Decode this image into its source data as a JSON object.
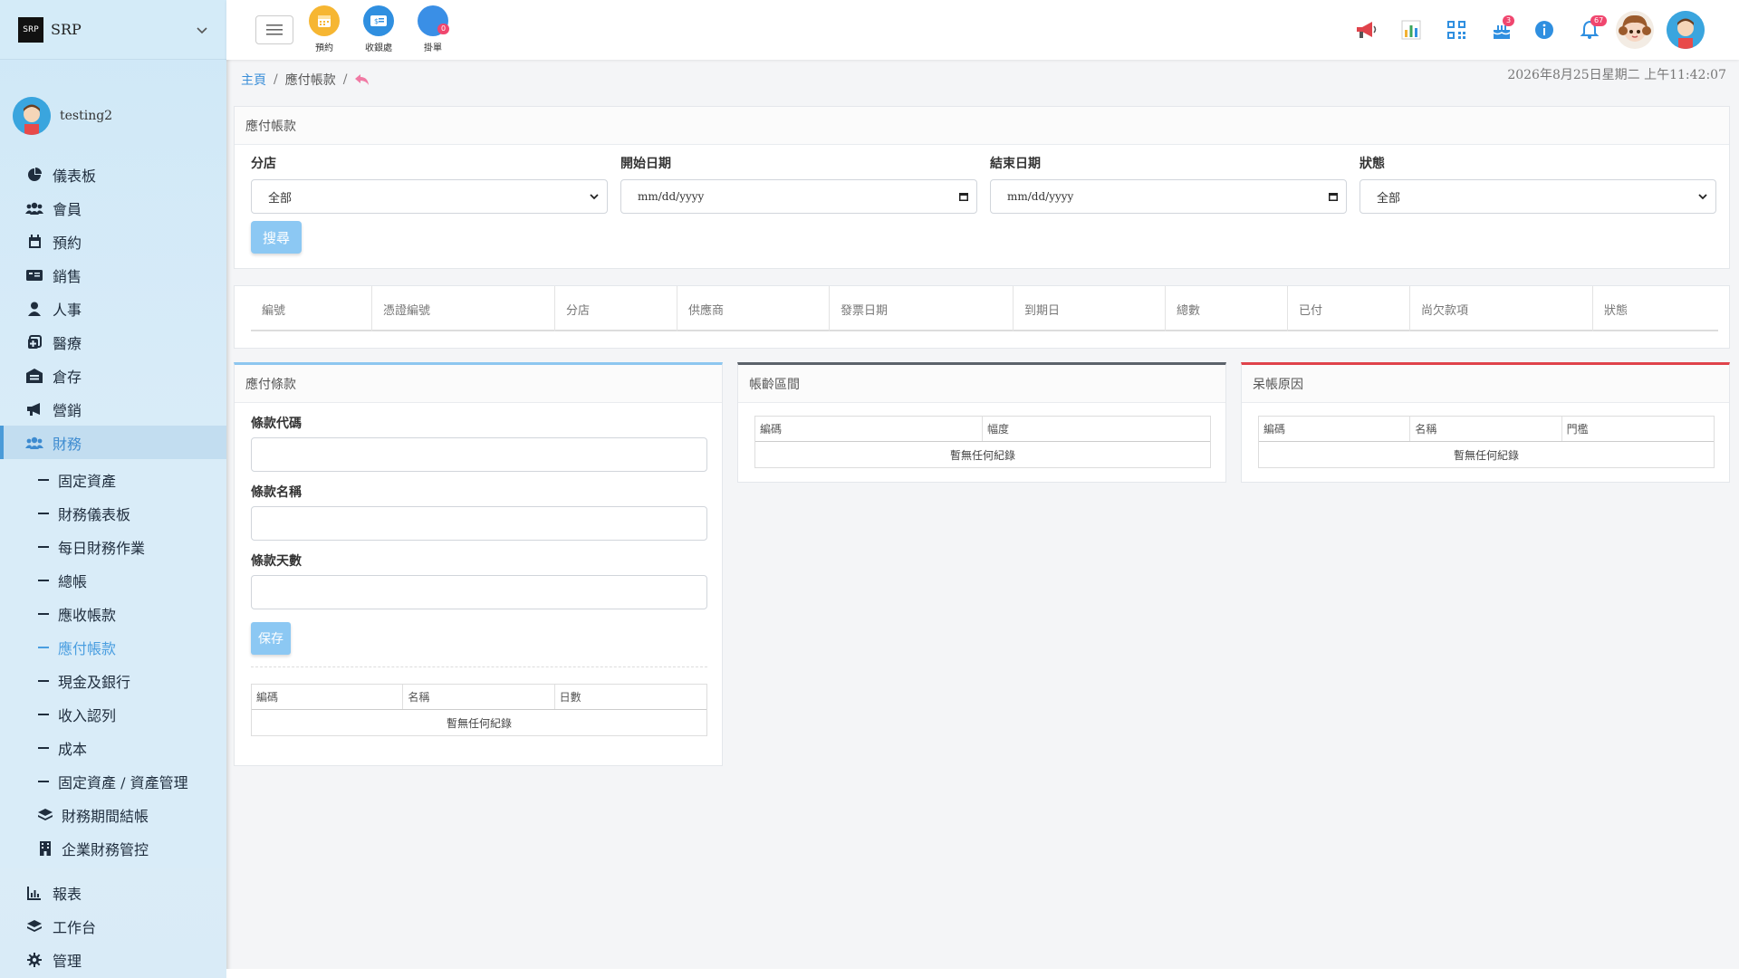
{
  "brand": {
    "name": "SRP",
    "logo_text": "SRP"
  },
  "user": {
    "name": "testing2"
  },
  "sidebar": {
    "items": [
      {
        "label": "儀表板",
        "icon": "pie-chart-icon"
      },
      {
        "label": "會員",
        "icon": "users-icon"
      },
      {
        "label": "預約",
        "icon": "calendar-icon"
      },
      {
        "label": "銷售",
        "icon": "id-card-icon"
      },
      {
        "label": "人事",
        "icon": "person-icon"
      },
      {
        "label": "醫療",
        "icon": "medical-icon"
      },
      {
        "label": "倉存",
        "icon": "warehouse-icon"
      },
      {
        "label": "營銷",
        "icon": "megaphone-icon"
      },
      {
        "label": "財務",
        "icon": "finance-users-icon"
      }
    ],
    "finance_sub": [
      {
        "label": "固定資產"
      },
      {
        "label": "財務儀表板"
      },
      {
        "label": "每日財務作業"
      },
      {
        "label": "總帳"
      },
      {
        "label": "應收帳款"
      },
      {
        "label": "應付帳款"
      },
      {
        "label": "現金及銀行"
      },
      {
        "label": "收入認列"
      },
      {
        "label": "成本"
      },
      {
        "label": "固定資產 / 資產管理"
      },
      {
        "label": "財務期間結帳"
      },
      {
        "label": "企業財務管控"
      }
    ],
    "bottom_items": [
      {
        "label": "報表"
      },
      {
        "label": "工作台"
      },
      {
        "label": "管理"
      }
    ]
  },
  "topbar": {
    "quick": [
      {
        "label": "預約",
        "color": "#f6b632"
      },
      {
        "label": "收銀處",
        "color": "#2f8fe0"
      },
      {
        "label": "掛單",
        "color": "#3a8fe6",
        "badge": "0"
      }
    ],
    "cake_badge": "3",
    "bell_badge": "67"
  },
  "breadcrumb": {
    "home": "主頁",
    "current": "應付帳款"
  },
  "datetime": "2026年8月25日星期二 上午11:42:07",
  "filter": {
    "title": "應付帳款",
    "branch_label": "分店",
    "branch_value": "全部",
    "start_label": "開始日期",
    "start_placeholder": "mm/dd/yyyy",
    "end_label": "結束日期",
    "end_placeholder": "mm/dd/yyyy",
    "status_label": "狀態",
    "status_value": "全部",
    "search_button": "搜尋"
  },
  "list_table": {
    "columns": [
      "編號",
      "憑證編號",
      "分店",
      "供應商",
      "發票日期",
      "到期日",
      "總數",
      "已付",
      "尚欠款項",
      "狀態"
    ]
  },
  "terms_panel": {
    "title": "應付條款",
    "code_label": "條款代碼",
    "name_label": "條款名稱",
    "days_label": "條款天數",
    "save_button": "保存",
    "columns": [
      "編碼",
      "名稱",
      "日數"
    ],
    "empty": "暫無任何紀錄"
  },
  "aging_panel": {
    "title": "帳齡區間",
    "columns": [
      "編碼",
      "幅度"
    ],
    "empty": "暫無任何紀錄"
  },
  "baddebt_panel": {
    "title": "呆帳原因",
    "columns": [
      "編碼",
      "名稱",
      "門檻"
    ],
    "empty": "暫無任何紀錄"
  }
}
